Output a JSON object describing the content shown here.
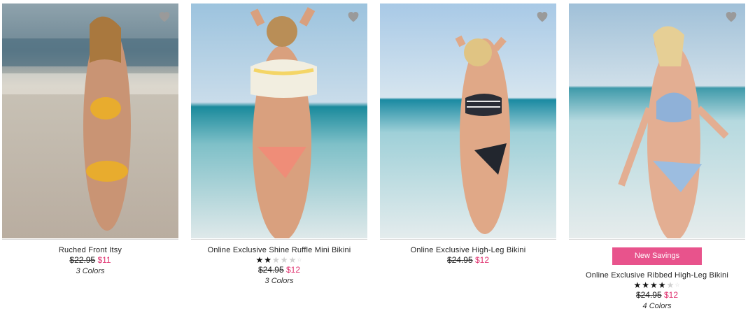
{
  "products": [
    {
      "name": "Ruched Front Itsy",
      "was_price": "$22.95",
      "sale_price": "$11",
      "colors": "3 Colors",
      "badge": "",
      "rating": null
    },
    {
      "name": "Online Exclusive Shine Ruffle Mini Bikini",
      "was_price": "$24.95",
      "sale_price": "$12",
      "colors": "3 Colors",
      "badge": "",
      "rating": 2
    },
    {
      "name": "Online Exclusive High-Leg Bikini",
      "was_price": "$24.95",
      "sale_price": "$12",
      "colors": "",
      "badge": "",
      "rating": null
    },
    {
      "name": "Online Exclusive Ribbed High-Leg Bikini",
      "was_price": "$24.95",
      "sale_price": "$12",
      "colors": "4 Colors",
      "badge": "New Savings",
      "rating": 4
    }
  ],
  "colors": {
    "sale_price": "#e0306e",
    "badge_bg": "#e8538c",
    "heart": "#9a9a9a"
  }
}
